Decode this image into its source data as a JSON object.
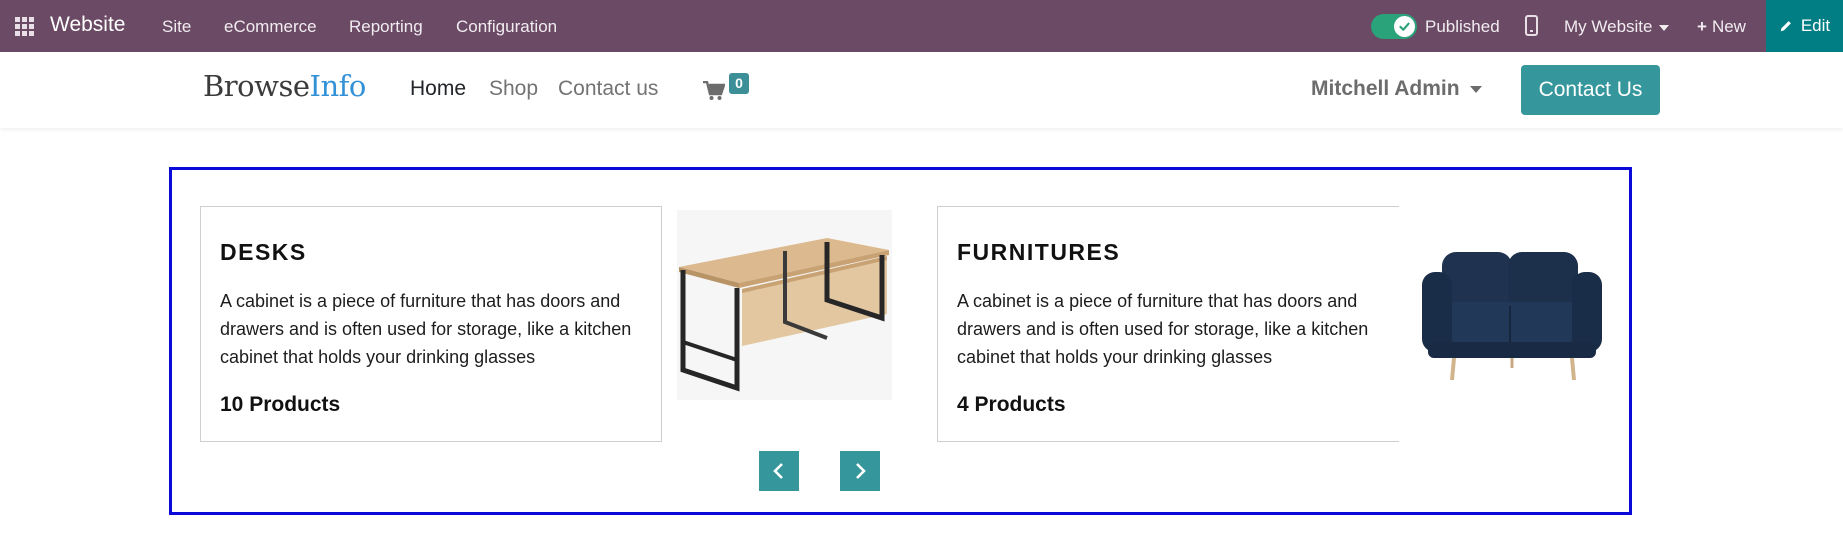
{
  "topbar": {
    "app_name": "Website",
    "menu": [
      "Site",
      "eCommerce",
      "Reporting",
      "Configuration"
    ],
    "published_label": "Published",
    "website_label": "My Website",
    "new_label": "New",
    "edit_label": "Edit",
    "published_on": true,
    "background_color": "#6b4a65",
    "edit_color": "#017e84"
  },
  "header": {
    "logo_part1": "Browse",
    "logo_part2": "Info",
    "nav": [
      "Home",
      "Shop",
      "Contact us"
    ],
    "cart_count": "0",
    "user_name": "Mitchell Admin",
    "contact_button": "Contact Us",
    "accent_color": "#35979c"
  },
  "carousel": {
    "border_color": "#0a0ad9",
    "items": [
      {
        "title": "DESKS",
        "description": "A cabinet is a piece of furniture that has doors and drawers and is often used for storage, like a kitchen cabinet that holds your drinking glasses",
        "count": "10 Products",
        "image": "desk-image"
      },
      {
        "title": "FURNITURES",
        "description": "A cabinet is a piece of furniture that has doors and drawers and is often used for storage, like a kitchen cabinet that holds your drinking glasses",
        "count": "4 Products",
        "image": "sofa-image"
      }
    ],
    "prev_icon": "chevron-left-icon",
    "next_icon": "chevron-right-icon"
  }
}
